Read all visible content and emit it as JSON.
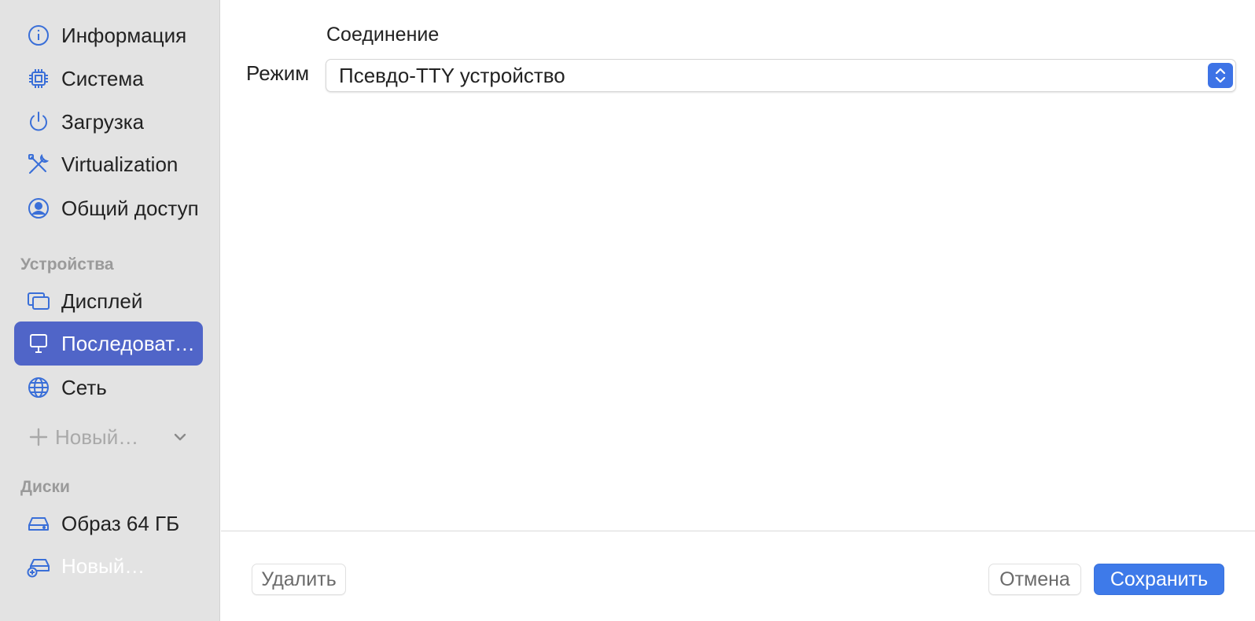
{
  "sidebar": {
    "items": [
      {
        "label": "Информация",
        "icon": "info-icon"
      },
      {
        "label": "Система",
        "icon": "cpu-icon"
      },
      {
        "label": "Загрузка",
        "icon": "power-icon"
      },
      {
        "label": "Virtualization",
        "icon": "tools-icon"
      },
      {
        "label": "Общий доступ",
        "icon": "person-circle-icon"
      }
    ],
    "devices_header": "Устройства",
    "devices": [
      {
        "label": "Дисплей",
        "icon": "display-icon"
      },
      {
        "label": "Последовательный порт",
        "icon": "serial-terminal-icon",
        "active": true
      },
      {
        "label": "Сеть",
        "icon": "globe-icon"
      }
    ],
    "add_new_label": "Новый…",
    "disks_header": "Диски",
    "disks": [
      {
        "label": "Образ 64 ГБ",
        "icon": "drive-icon"
      },
      {
        "label": "Новый…",
        "icon": "add-drive-icon"
      }
    ]
  },
  "main": {
    "section_title": "Соединение",
    "mode_label": "Режим",
    "mode_value": "Псевдо-TTY устройство"
  },
  "footer": {
    "delete_label": "Удалить",
    "cancel_label": "Отмена",
    "save_label": "Сохранить"
  },
  "colors": {
    "accent": "#3e7ae9",
    "sidebar_selection": "#5065c8",
    "sidebar_background": "#e3e3e3",
    "icon_blue": "#3a6fd8"
  }
}
